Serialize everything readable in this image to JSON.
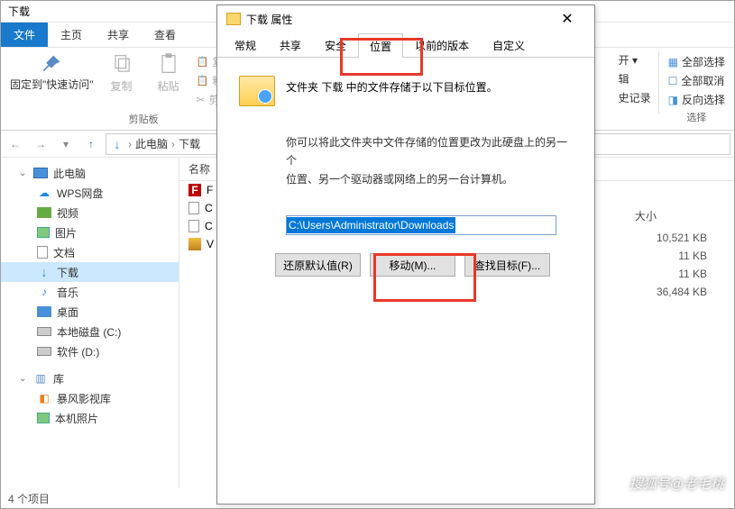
{
  "window": {
    "title": "下载"
  },
  "tabs": {
    "file": "文件",
    "home": "主页",
    "share": "共享",
    "view": "查看"
  },
  "ribbon": {
    "pin": "固定到\"快速访问\"",
    "copy": "复制",
    "paste": "粘贴",
    "copy_path": "复制路径",
    "paste_shortcut": "粘贴快捷方式",
    "cut": "剪切",
    "clipboard_group": "剪贴板",
    "right_col": {
      "open": "开 ▾",
      "edit": "辑",
      "history": "史记录"
    },
    "select_all": "全部选择",
    "select_none": "全部取消",
    "invert": "反向选择",
    "select_group": "选择"
  },
  "breadcrumb": {
    "pc": "此电脑",
    "downloads": "下载"
  },
  "tree": {
    "pc": "此电脑",
    "wps": "WPS网盘",
    "video": "视频",
    "pictures": "图片",
    "documents": "文档",
    "downloads": "下载",
    "music": "音乐",
    "desktop": "桌面",
    "cdisk": "本地磁盘 (C:)",
    "ddisk": "软件 (D:)",
    "libraries": "库",
    "storm": "暴风影视库",
    "photos": "本机照片"
  },
  "columns": {
    "name": "名称",
    "size": "大小"
  },
  "files": {
    "f1": {
      "name": "F",
      "size": "10,521 KB"
    },
    "f2": {
      "name": "C",
      "size": "11 KB"
    },
    "f3": {
      "name": "C",
      "size": "11 KB"
    },
    "f4": {
      "name": "V",
      "size": "36,484 KB"
    }
  },
  "status": {
    "count": "4 个项目"
  },
  "dialog": {
    "title": "下载 属性",
    "tabs": {
      "general": "常规",
      "share": "共享",
      "security": "安全",
      "location": "位置",
      "previous": "以前的版本",
      "custom": "自定义"
    },
    "desc": "文件夹 下载 中的文件存储于以下目标位置。",
    "info1": "你可以将此文件夹中文件存储的位置更改为此硬盘上的另一个",
    "info2": "位置、另一个驱动器或网络上的另一台计算机。",
    "path": "C:\\Users\\Administrator\\Downloads",
    "restore": "还原默认值(R)",
    "move": "移动(M)...",
    "find": "查找目标(F)..."
  },
  "watermark": "搜狐号@老毛桃"
}
